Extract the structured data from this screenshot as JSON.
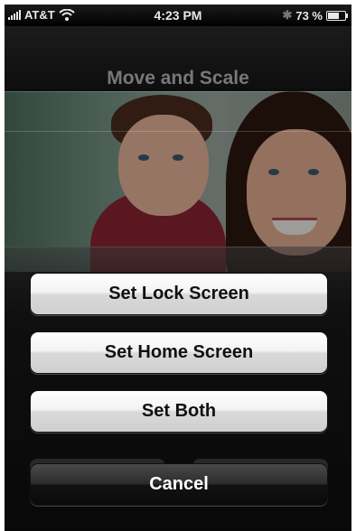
{
  "status_bar": {
    "carrier": "AT&T",
    "time": "4:23 PM",
    "battery_percent": "73 %",
    "battery_level": 0.73,
    "signal_icon": "signal-bars-icon",
    "wifi_icon": "wifi-icon",
    "bluetooth_icon": "bluetooth-icon"
  },
  "header": {
    "title": "Move and Scale"
  },
  "action_sheet": {
    "set_lock_screen": "Set Lock Screen",
    "set_home_screen": "Set Home Screen",
    "set_both": "Set Both",
    "cancel": "Cancel"
  },
  "colors": {
    "light_button": "#e6e6e6",
    "dark_button": "#1a1a1a",
    "title_text": "#b9b9b9"
  }
}
